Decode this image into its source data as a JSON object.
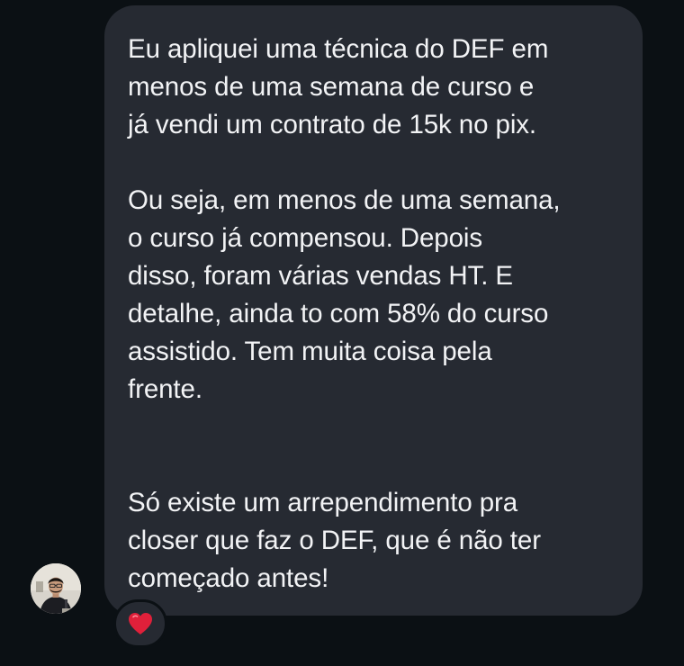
{
  "message": {
    "paragraphs": [
      "Eu apliquei uma técnica do DEF em\nmenos de uma semana de curso e\njá vendi um contrato de 15k no pix.",
      "Ou seja, em menos de uma semana,\no curso já compensou. Depois\ndisso, foram várias vendas HT. E\ndetalhe, ainda to com 58% do curso\nassistido. Tem muita coisa pela\nfrente.",
      "Só existe um arrependimento pra\ncloser que faz o DEF, que é não ter\ncomeçado antes!"
    ],
    "reaction": "heart-icon"
  },
  "sender": {
    "avatar": "avatar"
  },
  "colors": {
    "background": "#0b1014",
    "bubble": "#262a32",
    "text": "#f2f3f5",
    "heart": "#e0203a"
  }
}
